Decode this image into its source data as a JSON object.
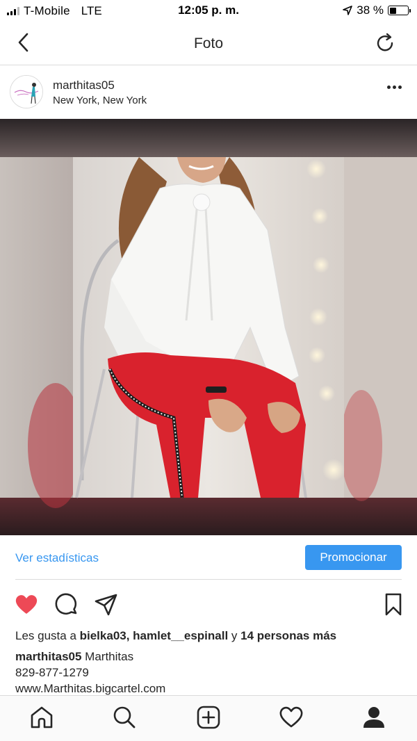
{
  "status_bar": {
    "carrier": "T-Mobile",
    "network": "LTE",
    "time": "12:05 p. m.",
    "battery": "38 %",
    "battery_level": 0.38
  },
  "nav": {
    "back_icon": "chevron-left-icon",
    "title": "Foto",
    "refresh_icon": "refresh-icon"
  },
  "post": {
    "username": "marthitas05",
    "location": "New York, New York",
    "more_icon": "more-horizontal-icon"
  },
  "stats": {
    "insights_link": "Ver estadísticas",
    "promote_button": "Promocionar"
  },
  "actions": {
    "like_icon": "heart-filled-icon",
    "comment_icon": "comment-icon",
    "share_icon": "send-icon",
    "save_icon": "bookmark-icon"
  },
  "likes": {
    "prefix": "Les gusta a ",
    "users": "bielka03, hamlet__espinall",
    "connector": " y ",
    "others": "14 personas más"
  },
  "caption": {
    "user": "marthitas05",
    "text": "Marthitas",
    "phone": "829-877-1279",
    "url": "www.Marthitas.bigcartel.com"
  },
  "tabbar": {
    "items": [
      "home-icon",
      "search-icon",
      "add-post-icon",
      "activity-heart-icon",
      "profile-icon"
    ]
  },
  "colors": {
    "accent": "#3897f0",
    "like": "#ed4956",
    "text": "#262626",
    "divider": "#dbdbdb"
  }
}
